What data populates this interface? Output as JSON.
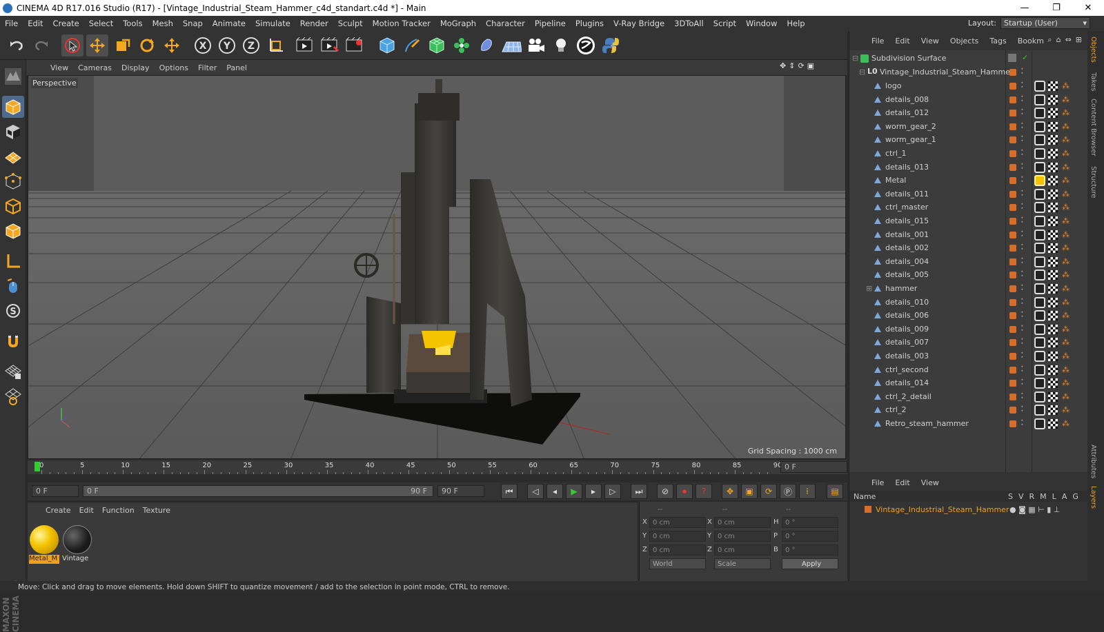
{
  "window": {
    "title": "CINEMA 4D R17.016 Studio (R17) - [Vintage_Industrial_Steam_Hammer_c4d_standart.c4d *] - Main",
    "minimize": "—",
    "maximize": "❐",
    "close": "✕"
  },
  "menu": [
    "File",
    "Edit",
    "Create",
    "Select",
    "Tools",
    "Mesh",
    "Snap",
    "Animate",
    "Simulate",
    "Render",
    "Sculpt",
    "Motion Tracker",
    "MoGraph",
    "Character",
    "Pipeline",
    "Plugins",
    "V-Ray Bridge",
    "3DToAll",
    "Script",
    "Window",
    "Help"
  ],
  "layout": {
    "label": "Layout:",
    "value": "Startup (User)"
  },
  "viewport": {
    "menu": [
      "View",
      "Cameras",
      "Display",
      "Options",
      "Filter",
      "Panel"
    ],
    "label": "Perspective",
    "grid_spacing": "Grid Spacing : 1000 cm"
  },
  "timeline": {
    "ticks": [
      "0",
      "5",
      "10",
      "15",
      "20",
      "25",
      "30",
      "35",
      "40",
      "45",
      "50",
      "55",
      "60",
      "65",
      "70",
      "75",
      "80",
      "85",
      "90"
    ],
    "current_frame": "0 F",
    "start_field": "0 F",
    "range_start": "0 F",
    "range_end": "90 F",
    "end_field": "90 F"
  },
  "materials": {
    "menu": [
      "Create",
      "Edit",
      "Function",
      "Texture"
    ],
    "items": [
      {
        "label": "Metal_M",
        "selected": true
      },
      {
        "label": "Vintage",
        "selected": false
      }
    ]
  },
  "coords": {
    "header": [
      "--",
      "--",
      "--"
    ],
    "rows": [
      {
        "l1": "X",
        "v1": "0 cm",
        "l2": "X",
        "v2": "0 cm",
        "l3": "H",
        "v3": "0 °"
      },
      {
        "l1": "Y",
        "v1": "0 cm",
        "l2": "Y",
        "v2": "0 cm",
        "l3": "P",
        "v3": "0 °"
      },
      {
        "l1": "Z",
        "v1": "0 cm",
        "l2": "Z",
        "v2": "0 cm",
        "l3": "B",
        "v3": "0 °"
      }
    ],
    "mode": "World",
    "scale": "Scale",
    "apply": "Apply"
  },
  "status": "Move: Click and drag to move elements. Hold down SHIFT to quantize movement / add to the selection in point mode, CTRL to remove.",
  "objects": {
    "menu": [
      "File",
      "Edit",
      "View",
      "Objects",
      "Tags",
      "Bookm"
    ],
    "root": "Subdivision Surface",
    "group": "Vintage_Industrial_Steam_Hammer",
    "children": [
      {
        "name": "logo",
        "tag": "dark"
      },
      {
        "name": "details_008",
        "tag": "dark"
      },
      {
        "name": "details_012",
        "tag": "dark"
      },
      {
        "name": "worm_gear_2",
        "tag": "dark"
      },
      {
        "name": "worm_gear_1",
        "tag": "dark"
      },
      {
        "name": "ctrl_1",
        "tag": "dark"
      },
      {
        "name": "details_013",
        "tag": "dark"
      },
      {
        "name": "Metal",
        "tag": "gold"
      },
      {
        "name": "details_011",
        "tag": "dark"
      },
      {
        "name": "ctrl_master",
        "tag": "dark"
      },
      {
        "name": "details_015",
        "tag": "dark"
      },
      {
        "name": "details_001",
        "tag": "dark"
      },
      {
        "name": "details_002",
        "tag": "dark"
      },
      {
        "name": "details_004",
        "tag": "dark"
      },
      {
        "name": "details_005",
        "tag": "dark"
      },
      {
        "name": "hammer",
        "tag": "dark",
        "expandable": true
      },
      {
        "name": "details_010",
        "tag": "dark"
      },
      {
        "name": "details_006",
        "tag": "dark"
      },
      {
        "name": "details_009",
        "tag": "dark"
      },
      {
        "name": "details_007",
        "tag": "dark"
      },
      {
        "name": "details_003",
        "tag": "dark"
      },
      {
        "name": "ctrl_second",
        "tag": "dark"
      },
      {
        "name": "details_014",
        "tag": "dark"
      },
      {
        "name": "ctrl_2_detail",
        "tag": "dark"
      },
      {
        "name": "ctrl_2",
        "tag": "dark"
      },
      {
        "name": "Retro_steam_hammer",
        "tag": "dark"
      }
    ]
  },
  "layers": {
    "menu": [
      "File",
      "Edit",
      "View"
    ],
    "columns": [
      "Name",
      "S",
      "V",
      "R",
      "M",
      "L",
      "A",
      "G"
    ],
    "row": "Vintage_Industrial_Steam_Hammer"
  },
  "side_tabs": [
    "Objects",
    "Takes",
    "Content Browser",
    "Structure",
    "Attributes",
    "Layers"
  ],
  "colors": {
    "accent": "#f0a020",
    "layer": "#d86d2a",
    "selection": "#4f6a8a"
  }
}
